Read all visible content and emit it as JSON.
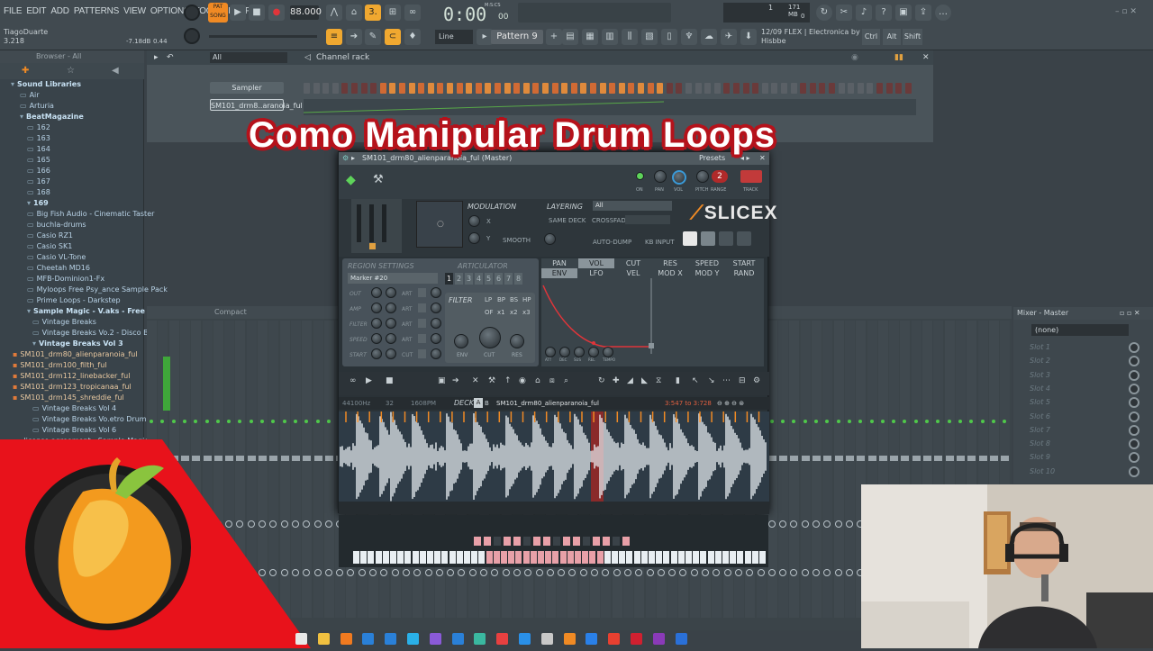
{
  "menu": [
    "FILE",
    "EDIT",
    "ADD",
    "PATTERNS",
    "VIEW",
    "OPTIONS",
    "TOOLS",
    "HELP"
  ],
  "transport": {
    "pat_label": "PAT",
    "song_label": "SONG",
    "tempo": "88.000",
    "time": "0:00",
    "time_small": "00",
    "time_unit": "M:S:CS",
    "pattern": "Pattern 9",
    "snap": "Line"
  },
  "hint": {
    "user": "TiagoDuarte",
    "value": "3.218",
    "db": "-7.18dB",
    "gain": "0.44"
  },
  "cpu": {
    "num": "1",
    "mem": "171 MB",
    "poly": "0"
  },
  "news": {
    "date": "12/09",
    "text": "FLEX | Electronica by Hisbbe"
  },
  "toolbar_right": [
    "Ctrl",
    "Alt",
    "Shift"
  ],
  "browser": {
    "title": "Browser - All",
    "items": [
      {
        "label": "Sound Libraries",
        "indent": 12,
        "type": "folder-open"
      },
      {
        "label": "Air",
        "indent": 22,
        "type": "folder"
      },
      {
        "label": "Arturia",
        "indent": 22,
        "type": "folder"
      },
      {
        "label": "BeatMagazine",
        "indent": 22,
        "type": "folder-open"
      },
      {
        "label": "162",
        "indent": 30,
        "type": "folder"
      },
      {
        "label": "163",
        "indent": 30,
        "type": "folder"
      },
      {
        "label": "164",
        "indent": 30,
        "type": "folder"
      },
      {
        "label": "165",
        "indent": 30,
        "type": "folder"
      },
      {
        "label": "166",
        "indent": 30,
        "type": "folder"
      },
      {
        "label": "167",
        "indent": 30,
        "type": "folder"
      },
      {
        "label": "168",
        "indent": 30,
        "type": "folder"
      },
      {
        "label": "169",
        "indent": 30,
        "type": "folder-open"
      },
      {
        "label": "Big Fish Audio - Cinematic Taster",
        "indent": 30,
        "type": "folder"
      },
      {
        "label": "buchla-drums",
        "indent": 30,
        "type": "folder"
      },
      {
        "label": "Casio RZ1",
        "indent": 30,
        "type": "folder"
      },
      {
        "label": "Casio SK1",
        "indent": 30,
        "type": "folder"
      },
      {
        "label": "Casio VL-Tone",
        "indent": 30,
        "type": "folder"
      },
      {
        "label": "Cheetah MD16",
        "indent": 30,
        "type": "folder"
      },
      {
        "label": "MFB-Dominion1-Fx",
        "indent": 30,
        "type": "folder"
      },
      {
        "label": "Myloops Free Psy_ance Sample Pack",
        "indent": 30,
        "type": "folder"
      },
      {
        "label": "Prime Loops - Darkstep",
        "indent": 30,
        "type": "folder"
      },
      {
        "label": "Sample Magic - V.aks - Free Pack",
        "indent": 30,
        "type": "folder-open"
      },
      {
        "label": "Vintage Breaks",
        "indent": 36,
        "type": "folder"
      },
      {
        "label": "Vintage Breaks Vo.2 - Disco Breaks",
        "indent": 36,
        "type": "folder"
      },
      {
        "label": "Vintage Breaks Vol 3",
        "indent": 36,
        "type": "folder-open"
      },
      {
        "label": "SM101_drm80_alienparanoia_ful",
        "indent": 14,
        "type": "file"
      },
      {
        "label": "SM101_drm100_filth_ful",
        "indent": 14,
        "type": "file"
      },
      {
        "label": "SM101_drm112_linebacker_ful",
        "indent": 14,
        "type": "file"
      },
      {
        "label": "SM101_drm123_tropicanaa_ful",
        "indent": 14,
        "type": "file"
      },
      {
        "label": "SM101_drm145_shreddie_ful",
        "indent": 14,
        "type": "file"
      },
      {
        "label": "Vintage Breaks Vol 4",
        "indent": 36,
        "type": "folder"
      },
      {
        "label": "Vintage Breaks Vo.etro Drum Fills",
        "indent": 36,
        "type": "folder"
      },
      {
        "label": "Vintage Breaks Vol 6",
        "indent": 36,
        "type": "folder"
      },
      {
        "label": "_license agreement - Sample Magic",
        "indent": 14,
        "type": "doc"
      }
    ]
  },
  "channel_rack": {
    "title": "Channel rack",
    "filter": "All",
    "channels": [
      {
        "name": "Sampler"
      },
      {
        "name": "SM101_drm8..aranoia_ful"
      }
    ]
  },
  "video_title": "Como Manipular Drum Loops",
  "slicex": {
    "title": "SM101_drm80_alienparanoia_ful (Master)",
    "presets": "Presets",
    "track_num": "2",
    "knob_labels": [
      "ON",
      "PAN",
      "VOL",
      "PITCH",
      "RANGE",
      "TRACK"
    ],
    "modulation": "MODULATION",
    "mod_x": "X",
    "mod_y": "Y",
    "smooth": "SMOOTH",
    "layering": "LAYERING",
    "layer_sel": "All",
    "same_deck": "SAME DECK",
    "crossfade": "CROSSFADE",
    "auto_dump": "AUTO-DUMP",
    "kb_input": "KB INPUT",
    "logo": "SLICEX",
    "region_settings": "REGION SETTINGS",
    "articulator": "ARTICULATOR",
    "marker": "Marker #20",
    "art_nums": [
      "1",
      "2",
      "3",
      "4",
      "5",
      "6",
      "7",
      "8"
    ],
    "region_rows": [
      "OUT",
      "AMP",
      "FILTER",
      "SPEED",
      "START"
    ],
    "art_labels": [
      "ART",
      "ART",
      "ART",
      "ART",
      "CUT"
    ],
    "filter": "FILTER",
    "filter_types": [
      "LP",
      "BP",
      "BS",
      "HP"
    ],
    "filter_poles": [
      "OF",
      "x1",
      "x2",
      "x3"
    ],
    "filter_knobs": [
      "ENV",
      "CUT",
      "RES"
    ],
    "env_tabs_top": [
      "PAN",
      "VOL",
      "CUT",
      "RES",
      "SPEED",
      "START"
    ],
    "env_tabs_bottom": [
      "ENV",
      "LFO",
      "VEL",
      "MOD X",
      "MOD Y",
      "RAND"
    ],
    "env_knobs": [
      "ATT",
      "DEC",
      "SUS",
      "REL",
      "TEMPO"
    ],
    "sample_rate": "44100Hz",
    "bits": "32",
    "sample_len": "1608PM",
    "deck": "DECK",
    "deck_a": "A",
    "deck_b": "B",
    "sample_name": "SM101_drm80_alienparanoia_ful",
    "range": "3:547 to 3:728"
  },
  "mixer": {
    "title": "Mixer - Master",
    "compact": "Compact",
    "insert": "(none)",
    "slots": [
      "Slot 1",
      "Slot 2",
      "Slot 3",
      "Slot 4",
      "Slot 5",
      "Slot 6",
      "Slot 7",
      "Slot 8",
      "Slot 9",
      "Slot 10"
    ]
  },
  "accent": "#f08a24",
  "taskbar_icons": [
    "windows-icon",
    "explorer-icon",
    "vlc-icon",
    "media-icon",
    "cloud-icon",
    "edge-icon",
    "vs-icon",
    "box-icon",
    "gitkraken-icon",
    "chrome-icon",
    "vscode-icon",
    "unity-icon",
    "blender-icon",
    "zoom-icon",
    "filezilla-icon",
    "opera-icon",
    "onenote-icon",
    "fl-icon"
  ]
}
